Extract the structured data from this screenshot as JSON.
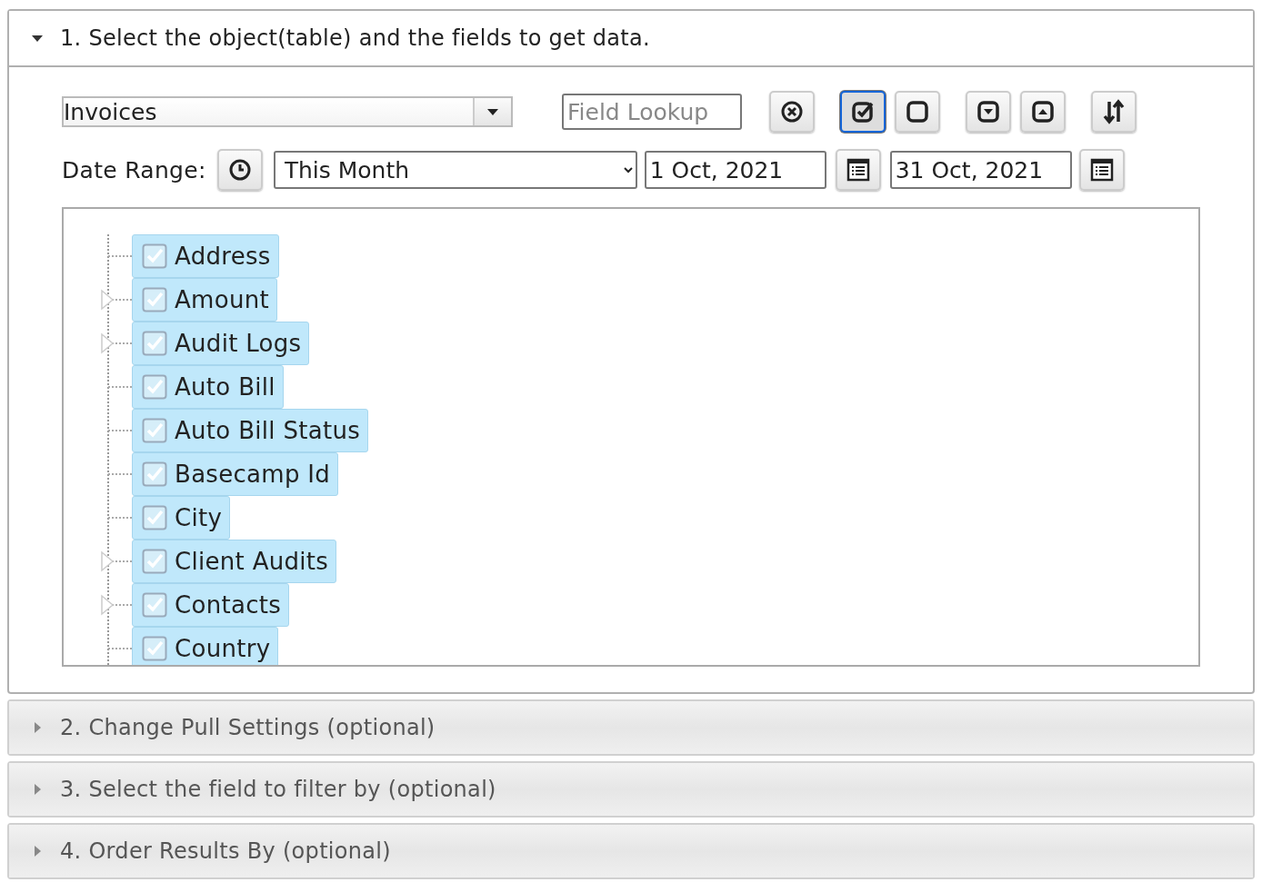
{
  "sections": [
    {
      "title": "1. Select the object(table) and the fields to get data.",
      "expanded": true
    },
    {
      "title": "2. Change Pull Settings (optional)",
      "expanded": false
    },
    {
      "title": "3. Select the field to filter by (optional)",
      "expanded": false
    },
    {
      "title": "4. Order Results By (optional)",
      "expanded": false
    }
  ],
  "object_select": {
    "value": "Invoices"
  },
  "field_lookup": {
    "placeholder": "Field Lookup"
  },
  "toolbar": [
    {
      "kind": "clear",
      "selected": false
    },
    {
      "kind": "check-all",
      "selected": true
    },
    {
      "kind": "uncheck-all",
      "selected": false
    },
    {
      "kind": "expand-all",
      "selected": false
    },
    {
      "kind": "collapse-all",
      "selected": false
    },
    {
      "kind": "sort",
      "selected": false
    }
  ],
  "date_range": {
    "label": "Date Range:",
    "preset": "This Month",
    "from": "1 Oct, 2021",
    "to": "31 Oct, 2021"
  },
  "fields": [
    {
      "label": "Address",
      "checked": true,
      "expandable": false
    },
    {
      "label": "Amount",
      "checked": true,
      "expandable": true
    },
    {
      "label": "Audit Logs",
      "checked": true,
      "expandable": true
    },
    {
      "label": "Auto Bill",
      "checked": true,
      "expandable": false
    },
    {
      "label": "Auto Bill Status",
      "checked": true,
      "expandable": false
    },
    {
      "label": "Basecamp Id",
      "checked": true,
      "expandable": false
    },
    {
      "label": "City",
      "checked": true,
      "expandable": false
    },
    {
      "label": "Client Audits",
      "checked": true,
      "expandable": true
    },
    {
      "label": "Contacts",
      "checked": true,
      "expandable": true
    },
    {
      "label": "Country",
      "checked": true,
      "expandable": false
    }
  ]
}
